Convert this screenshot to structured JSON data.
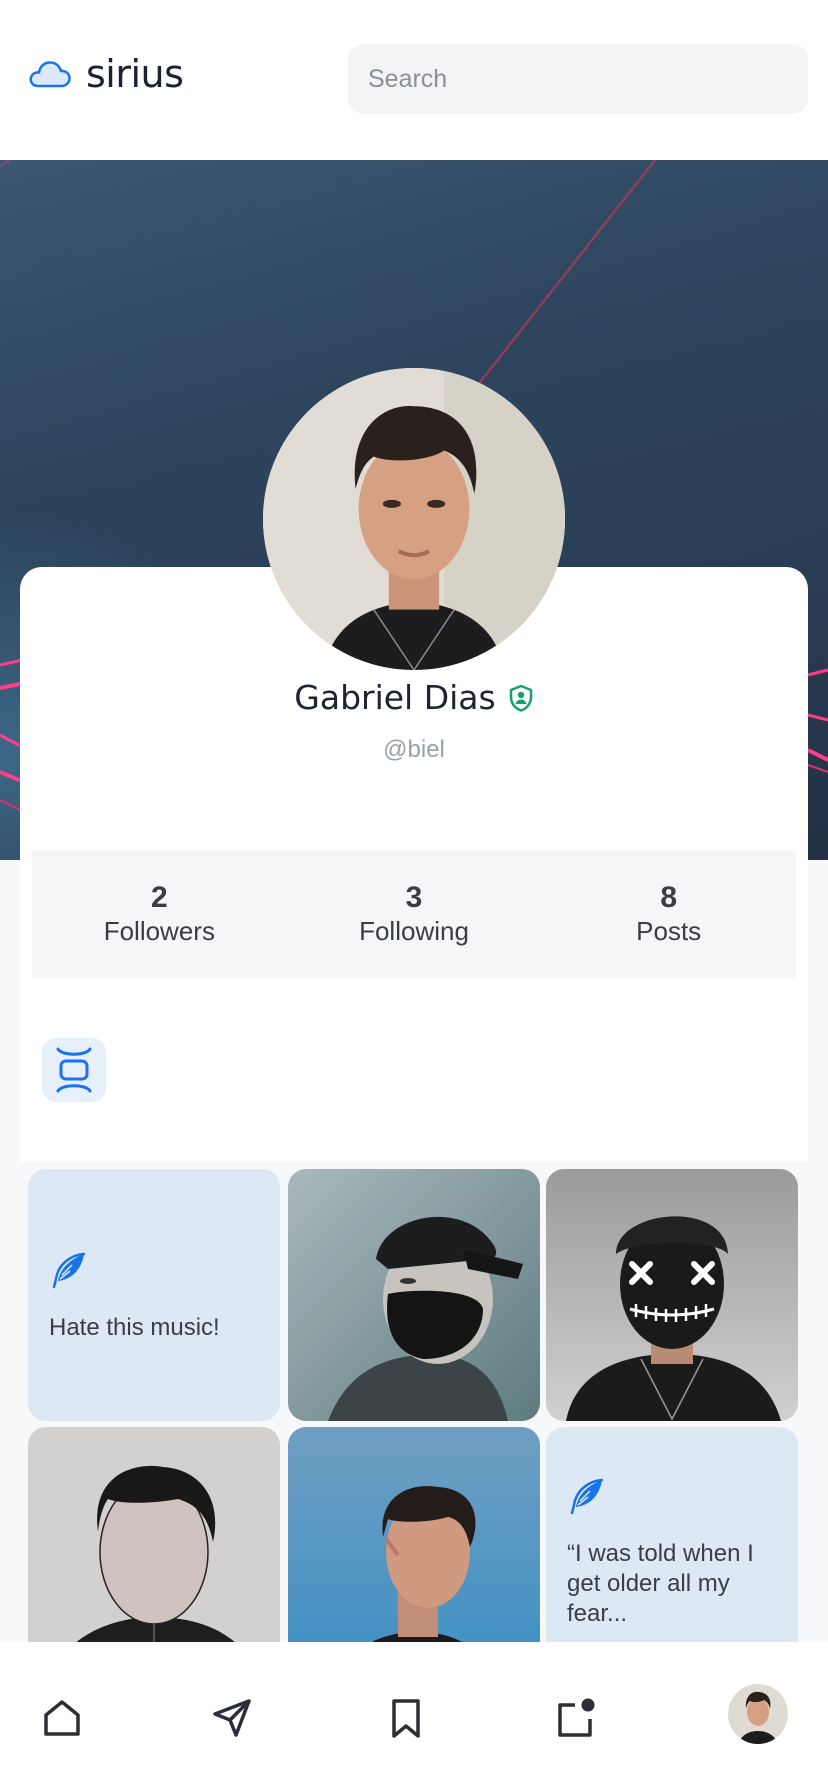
{
  "app": {
    "name": "sirius",
    "logo_icon": "cloud-icon",
    "accent_color": "#1a73e8"
  },
  "search": {
    "placeholder": "Search"
  },
  "profile": {
    "name": "Gabriel Dias",
    "handle": "@biel",
    "verified": true,
    "verified_icon": "shield-check-icon",
    "verified_color": "#12a36a"
  },
  "stats": [
    {
      "value": "2",
      "label": "Followers"
    },
    {
      "value": "3",
      "label": "Following"
    },
    {
      "value": "8",
      "label": "Posts"
    }
  ],
  "view_toggle": {
    "icon": "carousel-view-icon"
  },
  "posts": [
    {
      "type": "text",
      "text": "Hate this music!",
      "icon": "feather-icon"
    },
    {
      "type": "image",
      "icon": "photo"
    },
    {
      "type": "image",
      "icon": "photo"
    },
    {
      "type": "image",
      "icon": "photo"
    },
    {
      "type": "image",
      "icon": "photo"
    },
    {
      "type": "text",
      "text": "“I was told when I get older all my fear...",
      "icon": "feather-icon"
    }
  ],
  "bottom_nav": [
    {
      "name": "home",
      "icon": "home-icon"
    },
    {
      "name": "messages",
      "icon": "send-icon"
    },
    {
      "name": "saved",
      "icon": "bookmark-icon"
    },
    {
      "name": "notifications",
      "icon": "notification-icon"
    },
    {
      "name": "profile",
      "icon": "avatar"
    }
  ]
}
